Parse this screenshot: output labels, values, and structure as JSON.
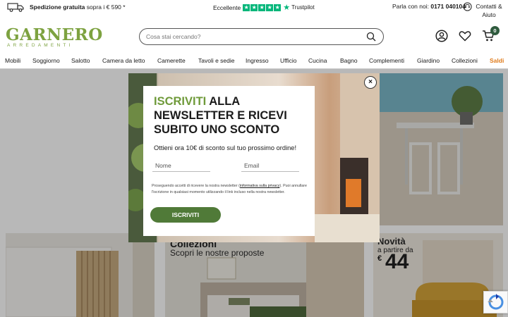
{
  "topbar": {
    "shipping_bold": "Spedizione gratuita",
    "shipping_rest": " sopra i € 590 *",
    "trust_label": "Eccellente",
    "trustpilot": "Trustpilot",
    "phone_prefix": "Parla con noi: ",
    "phone_number": "0171 040104",
    "contact_label": "Contatti & Aiuto"
  },
  "header": {
    "logo_main": "GARNERO",
    "logo_sub": "ARREDAMENTI",
    "search_placeholder": "Cosa stai cercando?",
    "cart_count": "0"
  },
  "nav": {
    "items": [
      "Mobili",
      "Soggiorno",
      "Salotto",
      "Camera da letto",
      "Camerette",
      "Tavoli e sedie",
      "Ingresso",
      "Ufficio",
      "Cucina",
      "Bagno",
      "Complementi",
      "Giardino",
      "Collezioni",
      "Saldi"
    ]
  },
  "cards": {
    "collezioni_title": "Collezioni",
    "collezioni_sub": "Scopri le nostre proposte",
    "novita_title": "Novità",
    "novita_sub": "a partire da",
    "novita_currency": "€",
    "novita_price": "44"
  },
  "modal": {
    "title_green": "ISCRIVITI",
    "title_rest": " ALLA NEWSLETTER E RICEVI SUBITO UNO SCONTO",
    "lead": "Ottieni ora 10€ di sconto sul tuo prossimo ordine!",
    "name_placeholder": "Nome",
    "email_placeholder": "Email",
    "note_before": "Proseguendo accetti di ricevere la nostra newsletter (",
    "note_link": "informativa sulla privacy",
    "note_after": "). Puoi annullare l'iscrizione in qualsiasi momento utilizzando il link incluso nella nostra newsletter.",
    "button": "ISCRIVITI",
    "close": "×"
  },
  "colors": {
    "brand_green": "#7da240",
    "button_green": "#507a38",
    "trustpilot_green": "#00b67a",
    "saldi_orange": "#e07b1a"
  }
}
